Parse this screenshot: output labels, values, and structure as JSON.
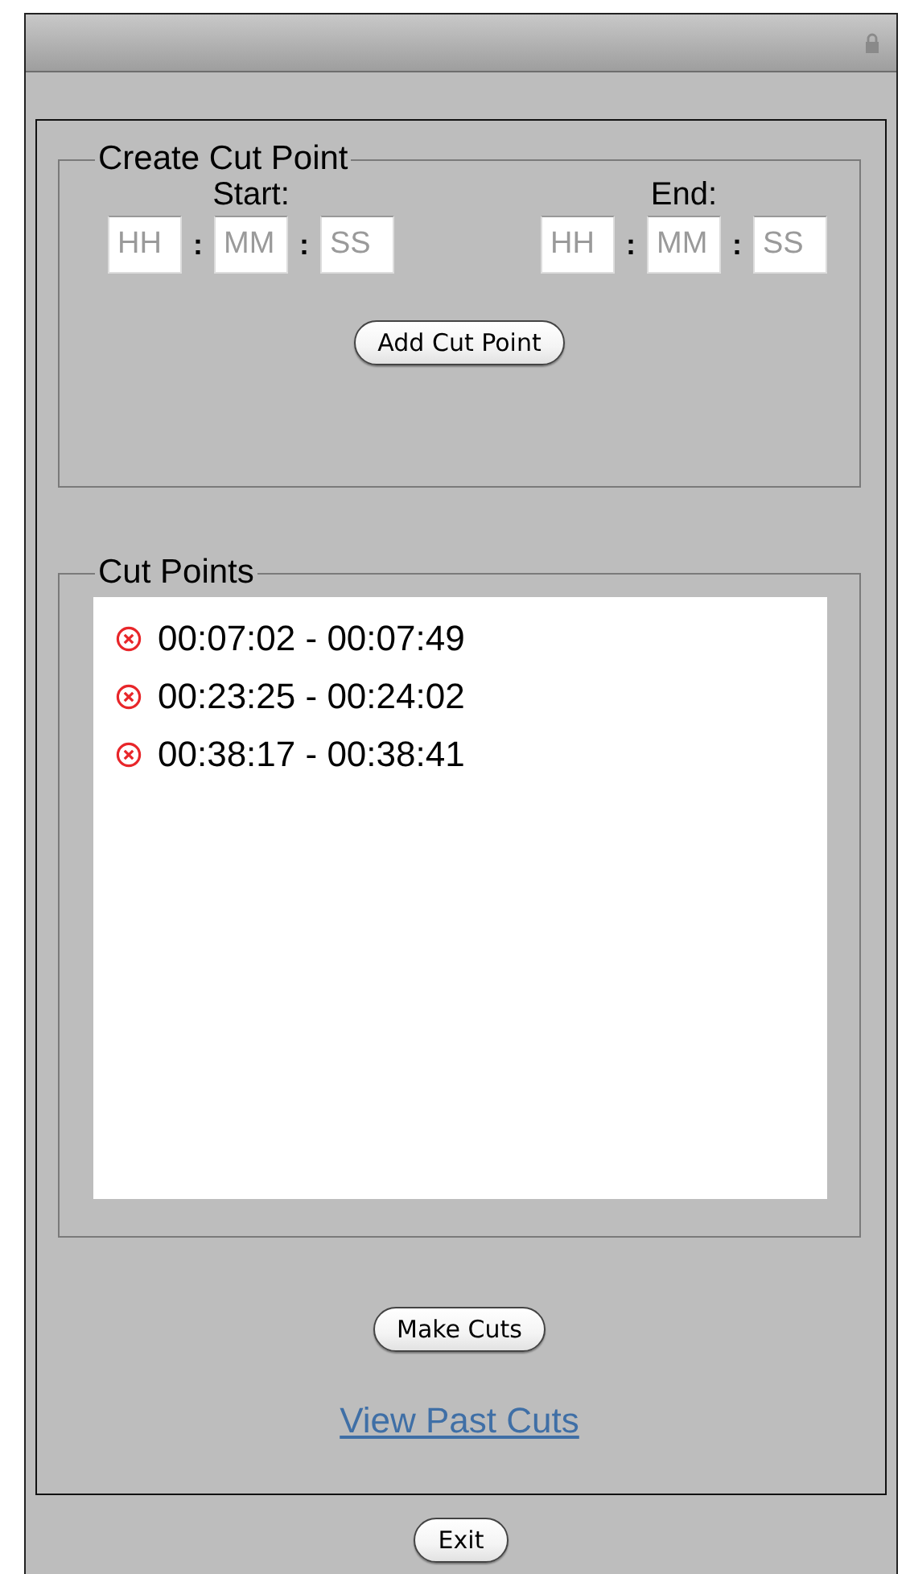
{
  "create_cut_point": {
    "title": "Create Cut Point",
    "groups": [
      {
        "label": "Start:",
        "parts": [
          {
            "kind": "field",
            "placeholder": "HH"
          },
          {
            "kind": "separator",
            "text": ":"
          },
          {
            "kind": "field",
            "placeholder": "MM"
          },
          {
            "kind": "separator",
            "text": ":"
          },
          {
            "kind": "field",
            "placeholder": "SS"
          }
        ]
      },
      {
        "label": "End:",
        "parts": [
          {
            "kind": "field",
            "placeholder": "HH"
          },
          {
            "kind": "separator",
            "text": ":"
          },
          {
            "kind": "field",
            "placeholder": "MM"
          },
          {
            "kind": "separator",
            "text": ":"
          },
          {
            "kind": "field",
            "placeholder": "SS"
          }
        ]
      }
    ],
    "button": "Add Cut Point"
  },
  "cut_points": {
    "title": "Cut Points",
    "items": [
      {
        "range": "00:07:02 - 00:07:49"
      },
      {
        "range": "00:23:25 - 00:24:02"
      },
      {
        "range": "00:38:17 - 00:38:41"
      }
    ]
  },
  "make_cuts_button": "Make Cuts",
  "view_past_cuts_link": "View Past Cuts",
  "exit_button": "Exit"
}
